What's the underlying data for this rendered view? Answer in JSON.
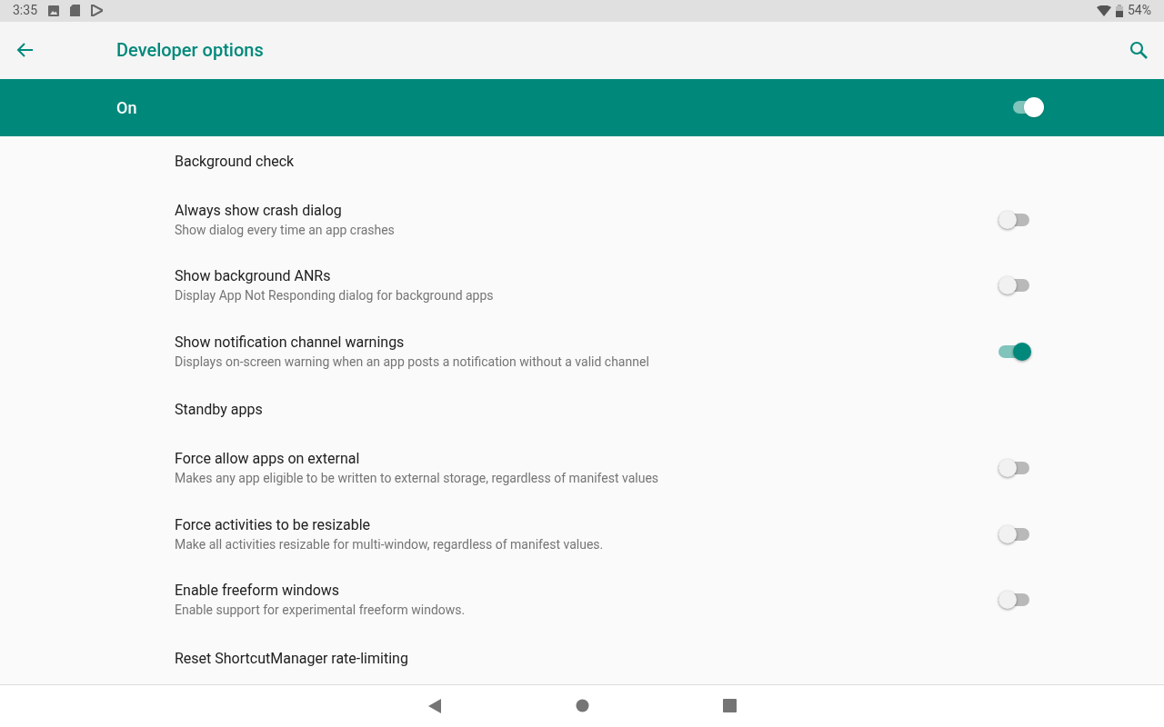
{
  "status_bar": {
    "time": "3:35",
    "battery": "54%"
  },
  "app_bar": {
    "title": "Developer options"
  },
  "master_switch": {
    "label": "On",
    "on": true
  },
  "items": [
    {
      "kind": "header",
      "title": "Background check"
    },
    {
      "kind": "toggle",
      "title": "Always show crash dialog",
      "summary": "Show dialog every time an app crashes",
      "on": false
    },
    {
      "kind": "toggle",
      "title": "Show background ANRs",
      "summary": "Display App Not Responding dialog for background apps",
      "on": false
    },
    {
      "kind": "toggle",
      "title": "Show notification channel warnings",
      "summary": "Displays on-screen warning when an app posts a notification without a valid channel",
      "on": true
    },
    {
      "kind": "header",
      "title": "Standby apps"
    },
    {
      "kind": "toggle",
      "title": "Force allow apps on external",
      "summary": "Makes any app eligible to be written to external storage, regardless of manifest values",
      "on": false
    },
    {
      "kind": "toggle",
      "title": "Force activities to be resizable",
      "summary": "Make all activities resizable for multi-window, regardless of manifest values.",
      "on": false
    },
    {
      "kind": "toggle",
      "title": "Enable freeform windows",
      "summary": "Enable support for experimental freeform windows.",
      "on": false
    },
    {
      "kind": "header",
      "title": "Reset ShortcutManager rate-limiting"
    }
  ]
}
